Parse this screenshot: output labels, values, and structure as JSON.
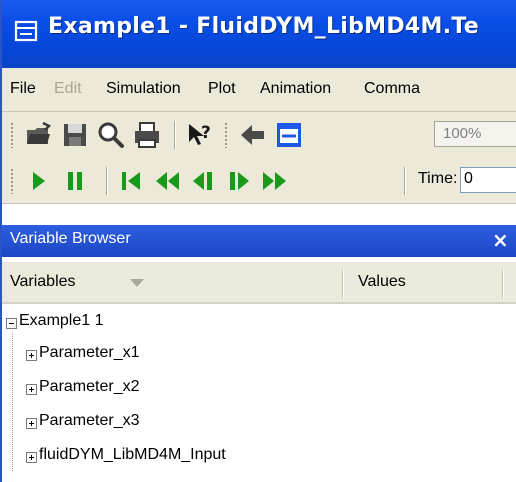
{
  "window": {
    "title": "Example1 - FluidDYM_LibMD4M.Te",
    "icon": "window-icon"
  },
  "menubar": {
    "items": [
      {
        "label": "File",
        "enabled": true
      },
      {
        "label": "Edit",
        "enabled": false
      },
      {
        "label": "Simulation",
        "enabled": true
      },
      {
        "label": "Plot",
        "enabled": true
      },
      {
        "label": "Animation",
        "enabled": true
      },
      {
        "label": "Comma",
        "enabled": true
      }
    ]
  },
  "toolbar1": {
    "icons": [
      "open-folder-icon",
      "save-icon",
      "search-icon",
      "print-icon",
      "context-help-icon",
      "back-arrow-icon",
      "window-icon"
    ],
    "zoom": "100%"
  },
  "toolbar2": {
    "icons": [
      "play-icon",
      "pause-icon",
      "go-to-start-icon",
      "rewind-icon",
      "step-back-icon",
      "step-forward-icon",
      "fast-forward-icon"
    ],
    "time_label": "Time:",
    "time_value": "0"
  },
  "variable_browser": {
    "title": "Variable Browser",
    "close_icon": "×",
    "columns": {
      "variables": "Variables",
      "values": "Values"
    },
    "tree": {
      "root": {
        "label": "Example1 1",
        "expanded": true
      },
      "children": [
        {
          "label": "Parameter_x1",
          "expanded": false
        },
        {
          "label": "Parameter_x2",
          "expanded": false
        },
        {
          "label": "Parameter_x3",
          "expanded": false
        },
        {
          "label": "fluidDYM_LibMD4M_Input",
          "expanded": false
        }
      ]
    }
  },
  "colors": {
    "titlebar": "#0a4ee8",
    "panel_header": "#1c46c4",
    "toolbar_bg": "#ece9d8",
    "play_green": "#1a9a1a"
  }
}
